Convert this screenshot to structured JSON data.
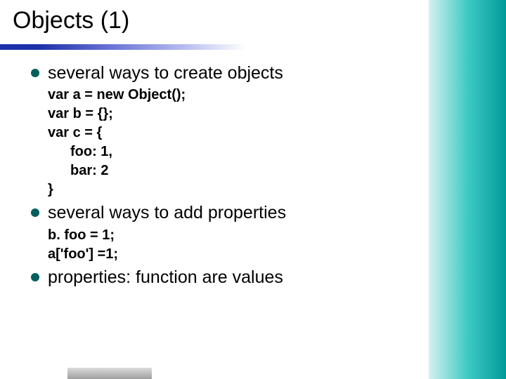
{
  "title": "Objects (1)",
  "bullets": [
    {
      "text": "several ways to create objects"
    },
    {
      "text": "several ways to add properties"
    },
    {
      "text": "properties: function are values"
    }
  ],
  "code_create": {
    "l1": "var a = new Object();",
    "l2": "var b = {};",
    "l3": "var c = {",
    "l4": "foo: 1,",
    "l5": "bar: 2",
    "l6": "}"
  },
  "code_add": {
    "l1": "b. foo = 1;",
    "l2": "a['foo'] =1;"
  }
}
